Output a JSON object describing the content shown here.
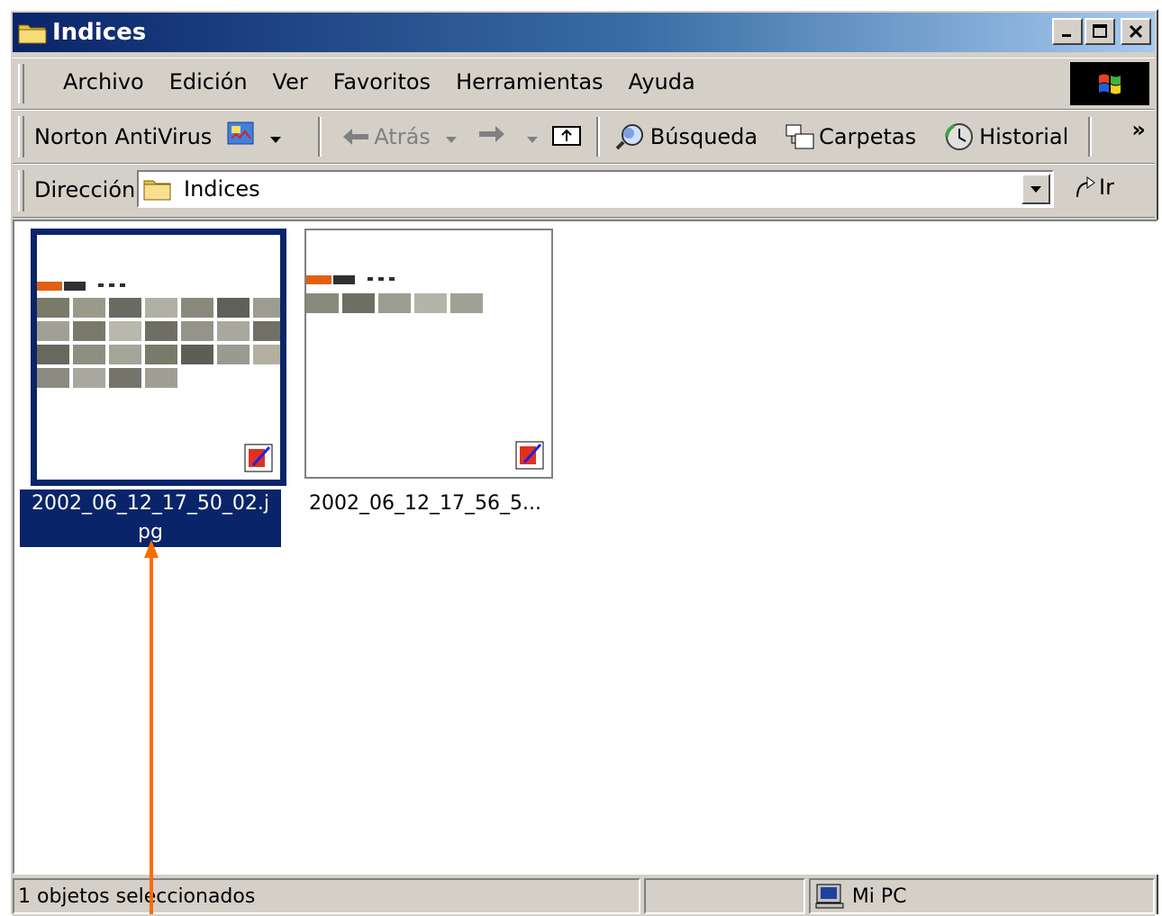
{
  "window": {
    "title": "Indices"
  },
  "menu": [
    "Archivo",
    "Edición",
    "Ver",
    "Favoritos",
    "Herramientas",
    "Ayuda"
  ],
  "toolbar": {
    "norton": "Norton AntiVirus",
    "back": "Atrás",
    "search": "Búsqueda",
    "folders": "Carpetas",
    "history": "Historial",
    "more": "»"
  },
  "address": {
    "label": "Dirección",
    "value": "Indices",
    "go": "Ir"
  },
  "files": [
    {
      "name": "2002_06_12_17_50_02.jpg",
      "caption_line1": "2002_06_12_17_50_02.j",
      "caption_line2": "pg",
      "selected": true
    },
    {
      "name": "2002_06_12_17_56_5...",
      "caption_line1": "2002_06_12_17_56_5...",
      "selected": false
    }
  ],
  "status": {
    "selected": "1 objetos seleccionados",
    "zone": "Mi PC"
  },
  "colors": {
    "selection": "#0a246a",
    "annotation_arrow": "#ff6a00",
    "title_start": "#0a246a",
    "title_end": "#a6caf0"
  }
}
